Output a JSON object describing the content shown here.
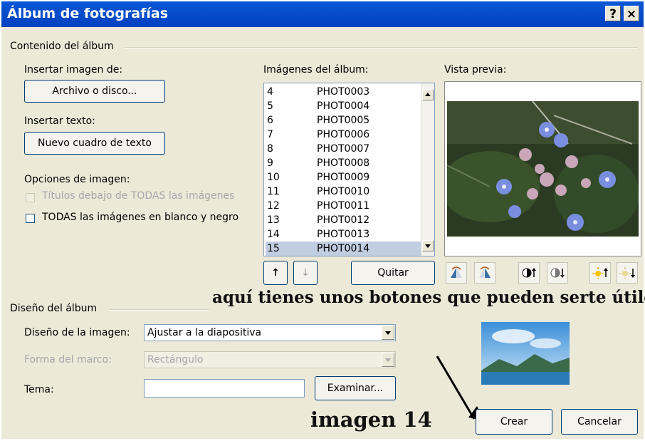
{
  "window": {
    "title": "Álbum de fotografías",
    "help_btn": "?",
    "close_btn": "×"
  },
  "contenido": {
    "group_label": "Contenido del álbum",
    "insert_image_label": "Insertar imagen de:",
    "file_button": "Archivo o disco...",
    "insert_text_label": "Insertar texto:",
    "text_box_button": "Nuevo cuadro de texto",
    "image_options_label": "Opciones de imagen:",
    "captions_label": "Títulos debajo de TODAS las imágenes",
    "bw_label": "TODAS las imágenes en blanco y negro"
  },
  "album": {
    "label": "Imágenes del álbum:",
    "items": [
      {
        "n": "4",
        "f": "PHOT0003"
      },
      {
        "n": "5",
        "f": "PHOT0004"
      },
      {
        "n": "6",
        "f": "PHOT0005"
      },
      {
        "n": "7",
        "f": "PHOT0006"
      },
      {
        "n": "8",
        "f": "PHOT0007"
      },
      {
        "n": "9",
        "f": "PHOT0008"
      },
      {
        "n": "10",
        "f": "PHOT0009"
      },
      {
        "n": "11",
        "f": "PHOT0010"
      },
      {
        "n": "12",
        "f": "PHOT0011"
      },
      {
        "n": "13",
        "f": "PHOT0012"
      },
      {
        "n": "14",
        "f": "PHOT0013"
      },
      {
        "n": "15",
        "f": "PHOT0014"
      }
    ],
    "selected_index": 11,
    "move_up": "↑",
    "move_down": "↓",
    "remove_button": "Quitar"
  },
  "preview": {
    "label": "Vista previa:"
  },
  "design": {
    "group_label": "Diseño del álbum",
    "layout_label": "Diseño de la imagen:",
    "layout_value": "Ajustar a la diapositiva",
    "frame_label": "Forma del marco:",
    "frame_value": "Rectángulo",
    "theme_label": "Tema:",
    "theme_value": "",
    "browse_button": "Examinar..."
  },
  "footer": {
    "create_button": "Crear",
    "cancel_button": "Cancelar"
  },
  "annotations": {
    "buttons_note": "aquí tienes unos botones que pueden serte útiles",
    "image_note": "imagen 14"
  },
  "colors": {
    "titlebar": "#0a58d6",
    "dialog_bg": "#ece9d8",
    "selection": "#c1cde0"
  }
}
